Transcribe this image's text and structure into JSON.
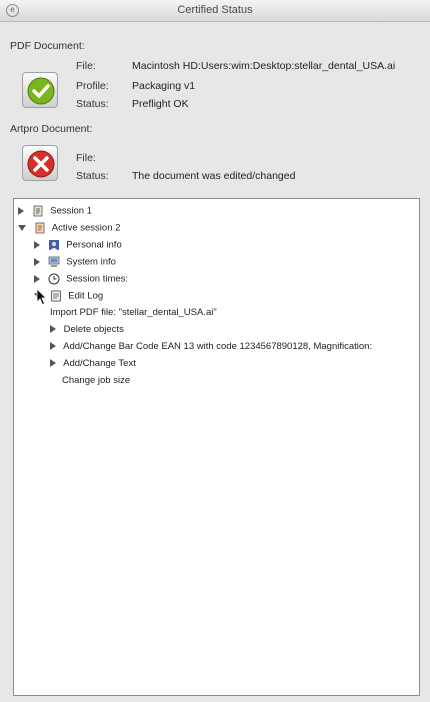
{
  "window": {
    "title": "Certified Status"
  },
  "pdf_document": {
    "heading": "PDF Document:",
    "file_label": "File:",
    "file_value": "Macintosh HD:Users:wim:Desktop:stellar_dental_USA.ai",
    "profile_label": "Profile:",
    "profile_value": "Packaging v1",
    "status_label": "Status:",
    "status_value": "Preflight OK",
    "status_icon": "check-icon",
    "status_color": "#7ab51d"
  },
  "artpro_document": {
    "heading": "Artpro Document:",
    "file_label": "File:",
    "status_label": "Status:",
    "status_value": "The document was edited/changed",
    "status_icon": "cross-icon",
    "status_color": "#d6302a"
  },
  "tree": {
    "items": [
      {
        "label": "Session 1",
        "icon": "session-icon",
        "expanded": false
      },
      {
        "label": "Active session 2",
        "icon": "session-icon",
        "expanded": true
      },
      {
        "label": "Personal info",
        "icon": "person-icon",
        "expanded": false
      },
      {
        "label": "System info",
        "icon": "computer-icon",
        "expanded": false
      },
      {
        "label": "Session times:",
        "icon": "clock-icon",
        "expanded": false
      },
      {
        "label": "Edit Log",
        "icon": "log-icon",
        "expanded": true
      },
      {
        "label": "Import PDF file: \"stellar_dental_USA.ai\""
      },
      {
        "label": "Delete objects",
        "expanded": false
      },
      {
        "label": "Add/Change Bar Code EAN 13 with code 1234567890128, Magnification:",
        "expanded": false
      },
      {
        "label": "Add/Change Text",
        "expanded": false
      },
      {
        "label": "Change job size"
      }
    ]
  }
}
